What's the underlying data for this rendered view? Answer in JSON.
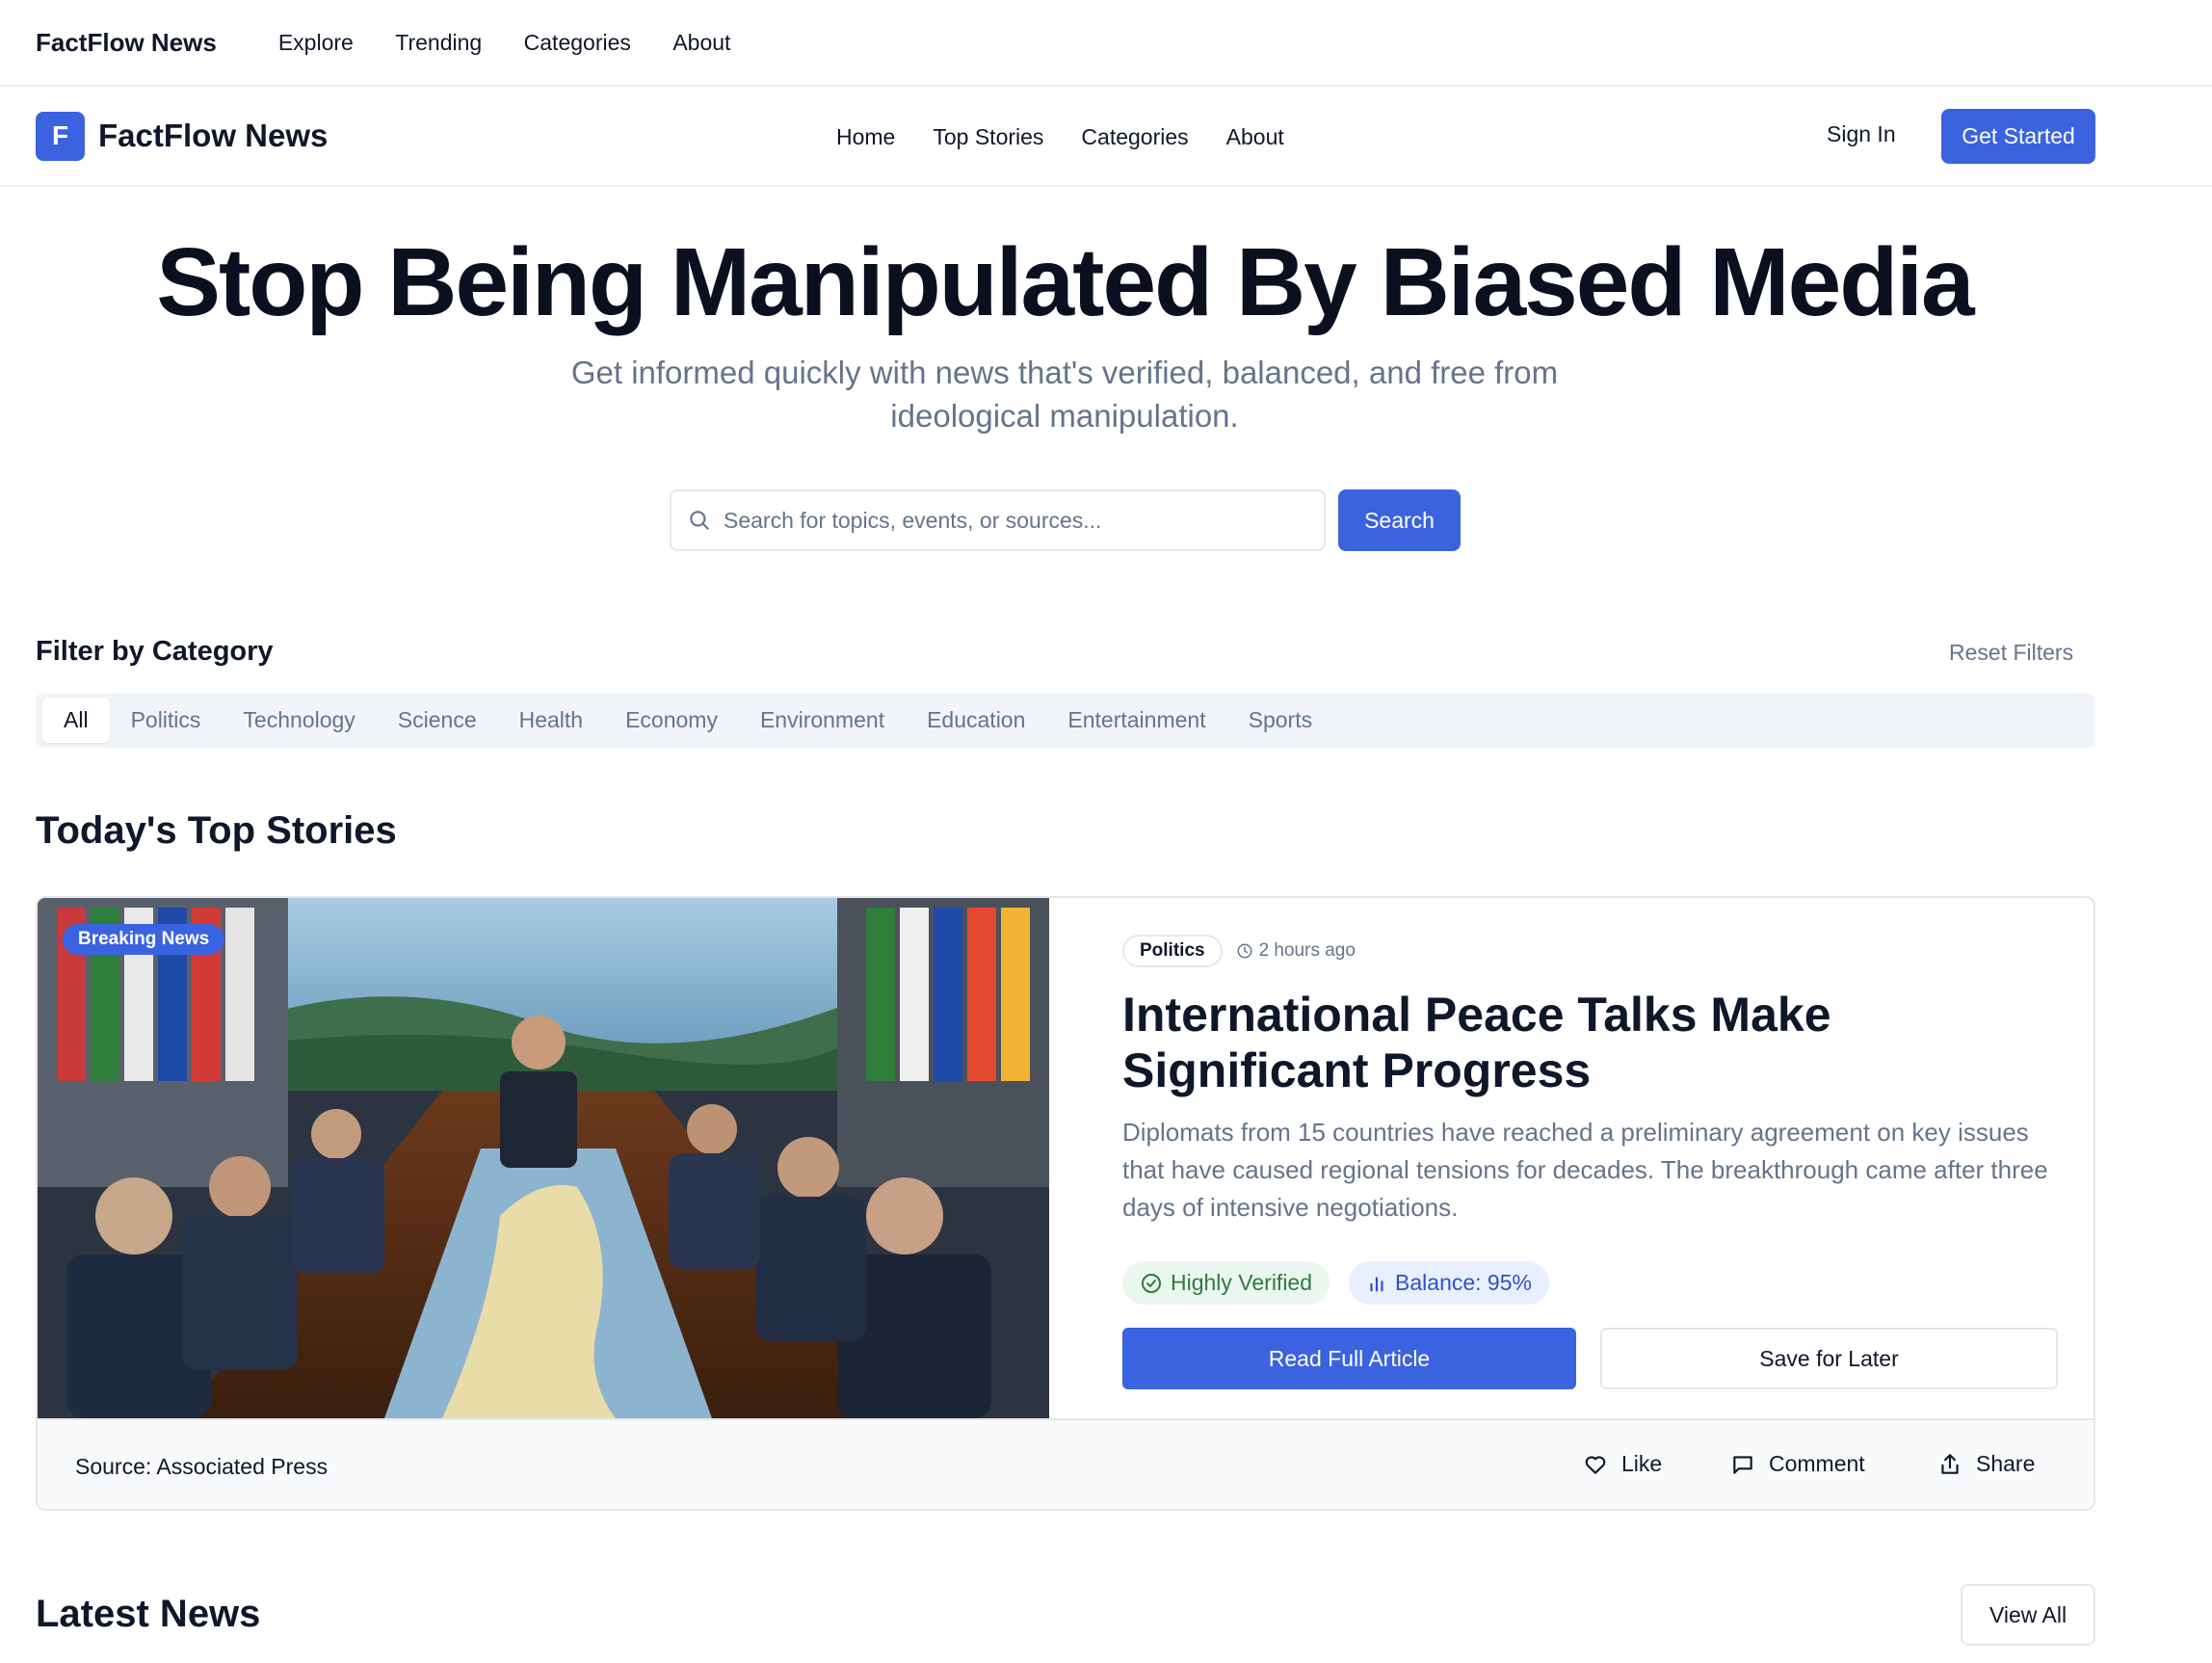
{
  "topbar": {
    "brand": "FactFlow News",
    "nav": [
      "Explore",
      "Trending",
      "Categories",
      "About"
    ]
  },
  "header": {
    "logo_letter": "F",
    "brand": "FactFlow News",
    "nav": [
      "Home",
      "Top Stories",
      "Categories",
      "About"
    ],
    "sign_in": "Sign In",
    "get_started": "Get Started"
  },
  "hero": {
    "title": "Stop Being Manipulated By Biased Media",
    "subtitle": "Get informed quickly with news that's verified, balanced, and free from ideological manipulation.",
    "search_placeholder": "Search for topics, events, or sources...",
    "search_value": "",
    "search_button": "Search"
  },
  "filter": {
    "title": "Filter by Category",
    "reset": "Reset Filters",
    "categories": [
      "All",
      "Politics",
      "Technology",
      "Science",
      "Health",
      "Economy",
      "Environment",
      "Education",
      "Entertainment",
      "Sports"
    ],
    "active": "All"
  },
  "top_stories": {
    "title": "Today's Top Stories",
    "featured": {
      "badge": "Breaking News",
      "category": "Politics",
      "time": "2 hours ago",
      "headline": "International Peace Talks Make Significant Progress",
      "description": "Diplomats from 15 countries have reached a preliminary agreement on key issues that have caused regional tensions for decades. The breakthrough came after three days of intensive negotiations.",
      "verified_label": "Highly Verified",
      "balance_label": "Balance: 95%",
      "read_button": "Read Full Article",
      "save_button": "Save for Later",
      "source": "Source: Associated Press",
      "like": "Like",
      "comment": "Comment",
      "share": "Share"
    }
  },
  "latest": {
    "title": "Latest News",
    "view_all": "View All"
  },
  "colors": {
    "accent": "#3b63e0",
    "verified_bg": "#eaf7ee",
    "verified_text": "#2f7a3f",
    "balance_bg": "#e8efff",
    "balance_text": "#2f52c4",
    "muted_text": "#64748b"
  },
  "icons": {
    "search": "search-icon",
    "clock": "clock-icon",
    "verified": "check-circle-icon",
    "balance": "bar-chart-icon",
    "like": "heart-icon",
    "comment": "comment-icon",
    "share": "share-icon"
  }
}
